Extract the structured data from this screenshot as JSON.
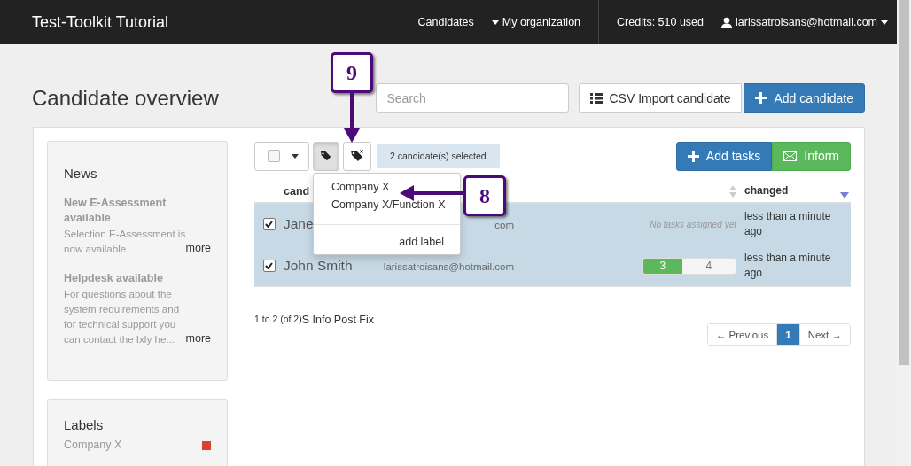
{
  "navbar": {
    "brand": "Test-Toolkit Tutorial",
    "links": [
      {
        "label": "Candidates",
        "kind": "link"
      },
      {
        "label": "My organization",
        "kind": "dropdown"
      }
    ],
    "credits": "Credits: 510 used",
    "user": "larissatroisans@hotmail.com"
  },
  "page": {
    "title": "Candidate overview",
    "search": {
      "placeholder": "Search"
    },
    "buttons": [
      {
        "label": "CSV Import candidate",
        "kind": "list"
      },
      {
        "label": "Add candidate",
        "kind": "add"
      }
    ]
  },
  "sidebar": {
    "news": {
      "title": "News",
      "items": [
        {
          "title": "New E-Assessment available",
          "text": "Selection E-Assessment is now available",
          "more": "more"
        },
        {
          "title": "Helpdesk available",
          "text": "For questions about the system requirements and for technical support you can contact the Ixly he...",
          "more": "more"
        }
      ]
    },
    "labels": {
      "title": "Labels",
      "items": [
        {
          "name": "Company X",
          "color": "#d9432b"
        }
      ]
    }
  },
  "toolbar": {
    "select_all_checked": false,
    "tag_active": true,
    "selected_count": "2 candidate(s) selected",
    "actions": [
      {
        "label": "Add tasks",
        "kind": "add"
      },
      {
        "label": "Inform",
        "kind": "mail"
      }
    ]
  },
  "label_menu": {
    "items": [
      "Company X",
      "Company X/Function X"
    ],
    "action": "add label"
  },
  "table": {
    "candidate_header": "cand",
    "changed_header": "changed",
    "rows": [
      {
        "selected": true,
        "name": "Jane",
        "email": "com",
        "kind": "empty",
        "tasks_text": "No tasks assigned yet",
        "changed": "less than a minute ago"
      },
      {
        "selected": true,
        "name": "John Smith",
        "email": "larissatroisans@hotmail.com",
        "kind": "progress",
        "done": "3",
        "open": "4",
        "level": 0.42,
        "changed": "less than a minute ago"
      }
    ]
  },
  "footer": {
    "range": "1 to 2 (of 2)",
    "extra": "S Info Post Fix"
  },
  "pagination": {
    "previous": "← Previous",
    "pages": [
      {
        "label": "1",
        "selected": true
      }
    ],
    "next": "Next →"
  },
  "callouts": [
    {
      "number": "9",
      "kind": "down"
    },
    {
      "number": "8",
      "kind": "left"
    }
  ]
}
